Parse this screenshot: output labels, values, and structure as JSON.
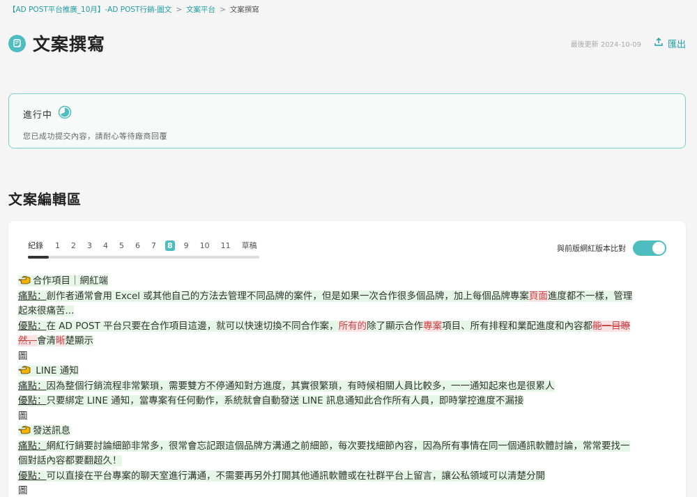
{
  "breadcrumb": {
    "project": "【AD POST平台推廣_10月】-AD POST行銷-圖文",
    "platform": "文案平台",
    "current": "文案撰寫",
    "sep": ">"
  },
  "header": {
    "title": "文案撰寫",
    "title_icon": "edit-note-icon",
    "last_updated": "最後更新 2024-10-09",
    "export_label": "匯出",
    "export_icon": "upload-icon"
  },
  "status": {
    "title": "進行中",
    "icon": "progress-half-icon",
    "description": "您已成功提交內容，請耐心等待廠商回覆"
  },
  "editor": {
    "section_title": "文案編輯區",
    "versions_label": "紀錄",
    "versions": [
      "1",
      "2",
      "3",
      "4",
      "5",
      "6",
      "7",
      "8",
      "9",
      "10",
      "11",
      "草稿"
    ],
    "active_version": "8",
    "compare_label": "與前版網紅版本比對",
    "compare_enabled": true
  },
  "content": {
    "h1": "合作項目｜網紅端",
    "l1_label": "痛點：",
    "l1_a": "創作者通常會用 Excel 或其他自己的方法去管理不同品牌的案件，但是如果一次合作很多個品牌，加上每個品牌專案",
    "l1_ins": "頁面",
    "l1_b": "進度都不一樣，管理",
    "l1_c": "起來很痛苦...",
    "l2_label": "優點：",
    "l2_a": "在 AD POST 平台只要在合作項目這邊，就可以快速切換不同合作案，",
    "l2_ins1": "所有的",
    "l2_b": "除了顯示合作",
    "l2_ins2": "專案",
    "l2_c": "項目、所有排程和業配進度和內容都",
    "l2_del1": "能一目瞭",
    "l2_del2": "然，",
    "l2_d": "會清",
    "l2_ins3": "晰",
    "l2_e": "楚顯示",
    "img1": "圖",
    "h2": "LINE 通知",
    "l3_label": "痛點：",
    "l3": "因為整個行銷流程非常繁瑣，需要雙方不停通知對方進度，其實很繁瑣，有時候相關人員比較多，一一通知起來也是很累人",
    "l4_label": "優點：",
    "l4": "只要綁定 LINE 通知，當專案有任何動作，系統就會自動發送 LINE 訊息通知此合作所有人員，即時掌控進度不漏接",
    "img2": "圖",
    "h3": "發送訊息",
    "l5_label": "痛點：",
    "l5_a": "網紅行銷要討論細節非常多，很常會忘記跟這個品牌方溝通之前細節，每次要找細節內容，因為所有事情在同一個通訊軟體討論，常常要找一",
    "l5_b": "個對話內容都要翻超久！",
    "l6_label": "優點：",
    "l6": "可以直接在平台專案的聊天室進行溝通，不需要再另外打開其他通訊軟體或在社群平台上留言，讓公私領域可以清楚分開",
    "img3": "圖"
  }
}
